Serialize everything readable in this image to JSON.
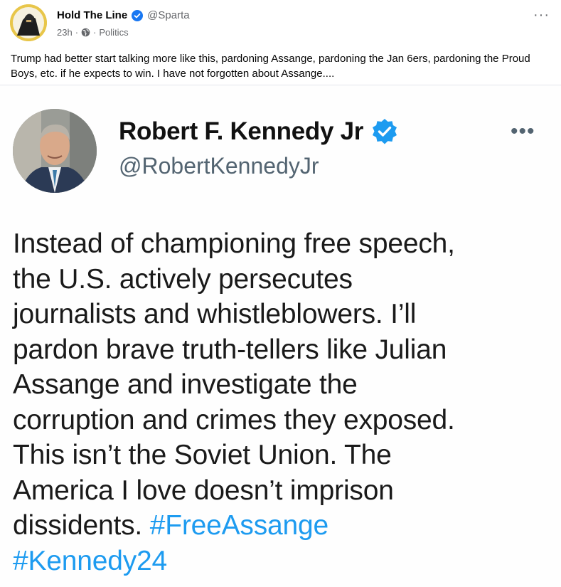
{
  "post": {
    "author": "Hold The Line",
    "handle": "@Sparta",
    "time": "23h",
    "separator": "·",
    "category": "Politics",
    "more_label": "···",
    "text": "Trump had better start talking more like this, pardoning Assange, pardoning the Jan 6ers, pardoning the Proud Boys, etc. if he expects to win. I have not forgotten about Assange...."
  },
  "embedded_tweet": {
    "name": "Robert F. Kennedy Jr",
    "handle": "@RobertKennedyJr",
    "more_label": "•••",
    "lines": [
      "Instead of championing free speech,",
      "the U.S. actively persecutes",
      "journalists and whistleblowers. I’ll",
      "pardon brave truth-tellers like Julian",
      "Assange and investigate the",
      "corruption and crimes they exposed.",
      "This isn’t the Soviet Union. The",
      "America I love doesn’t imprison"
    ],
    "last_line_text": "dissidents.",
    "hashtag1": "#FreeAssange",
    "hashtag2": "#Kennedy24"
  },
  "colors": {
    "verified_blue": "#1d9bf0",
    "fb_verified": "#1877f2",
    "text_secondary": "#65676b",
    "hashtag": "#1d9bf0"
  },
  "icons": {
    "verified": "verified-badge-icon",
    "globe": "globe-icon",
    "more": "more-options-icon"
  }
}
